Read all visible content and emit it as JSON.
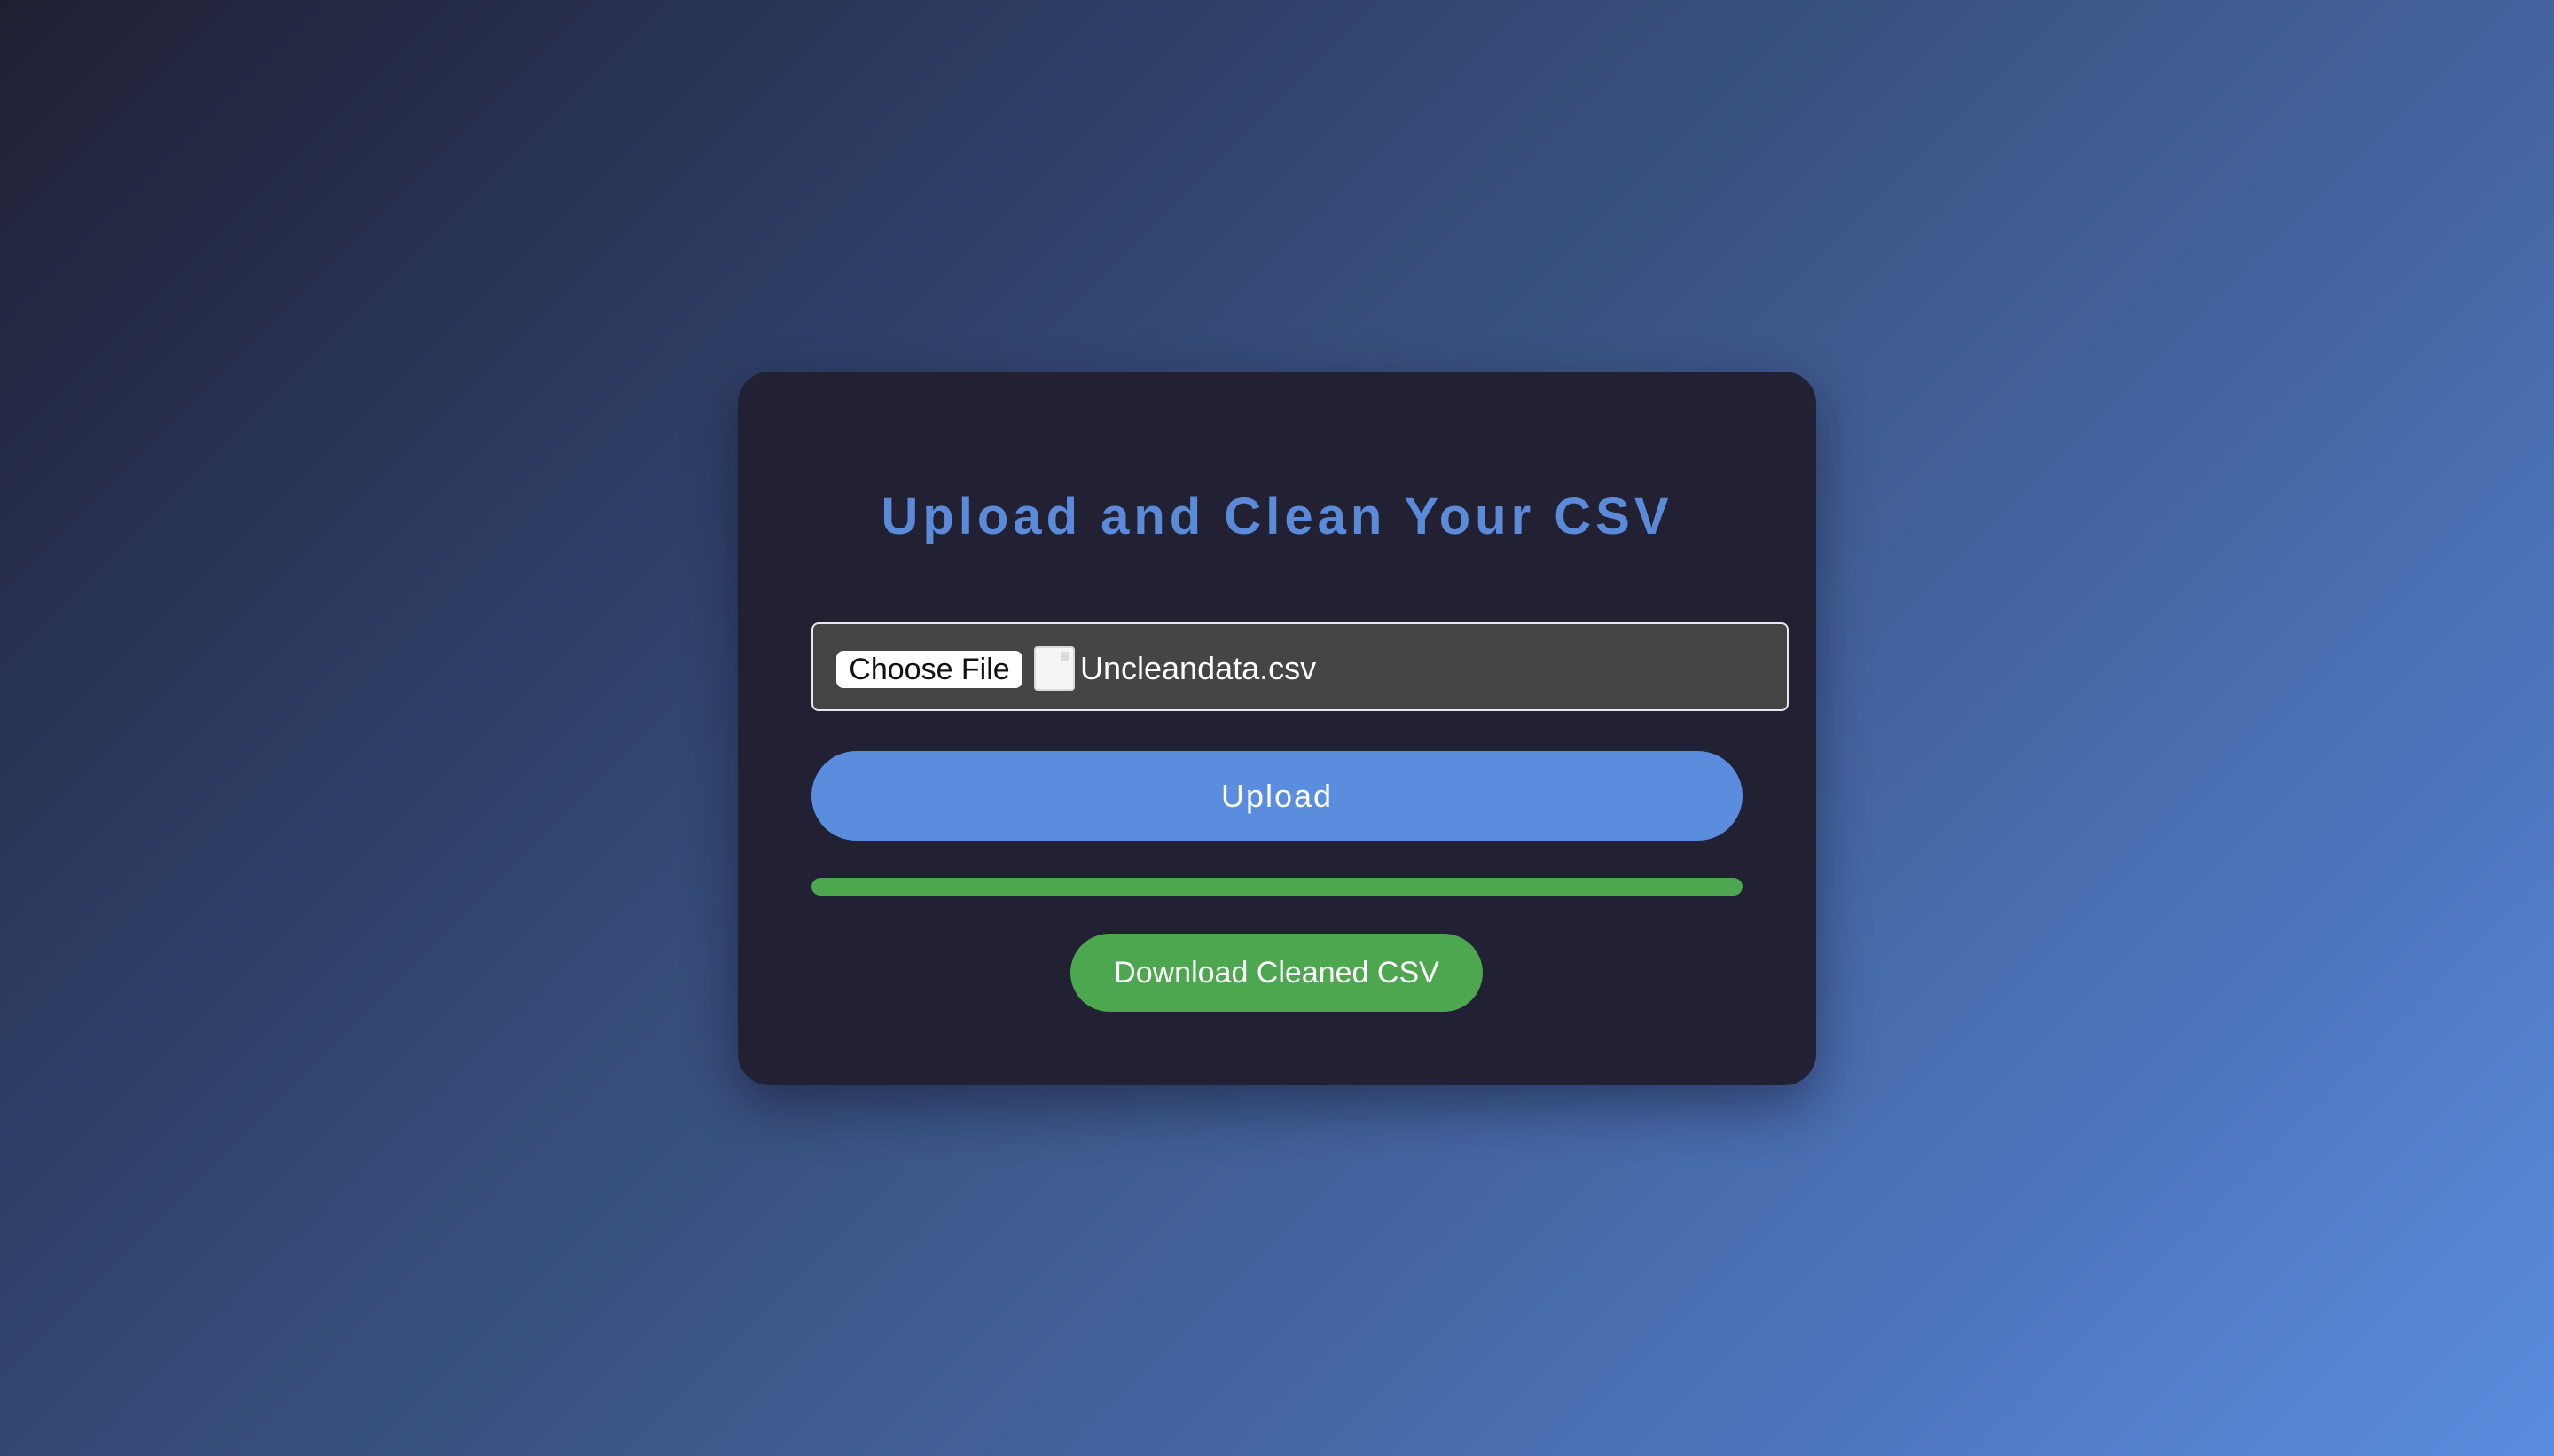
{
  "page": {
    "title": "Upload and Clean Your CSV"
  },
  "file_input": {
    "button_label": "Choose File",
    "file_name": "Uncleandata.csv",
    "icon": "file-icon"
  },
  "upload": {
    "label": "Upload"
  },
  "progress": {
    "percent": 100
  },
  "download": {
    "label": "Download Cleaned CSV"
  },
  "colors": {
    "title": "#5b8ad8",
    "upload_button": "#5b8dde",
    "progress_fill": "#4da74f",
    "download_button": "#4da74f",
    "card_background": "#212133",
    "file_box_background": "#454545"
  }
}
